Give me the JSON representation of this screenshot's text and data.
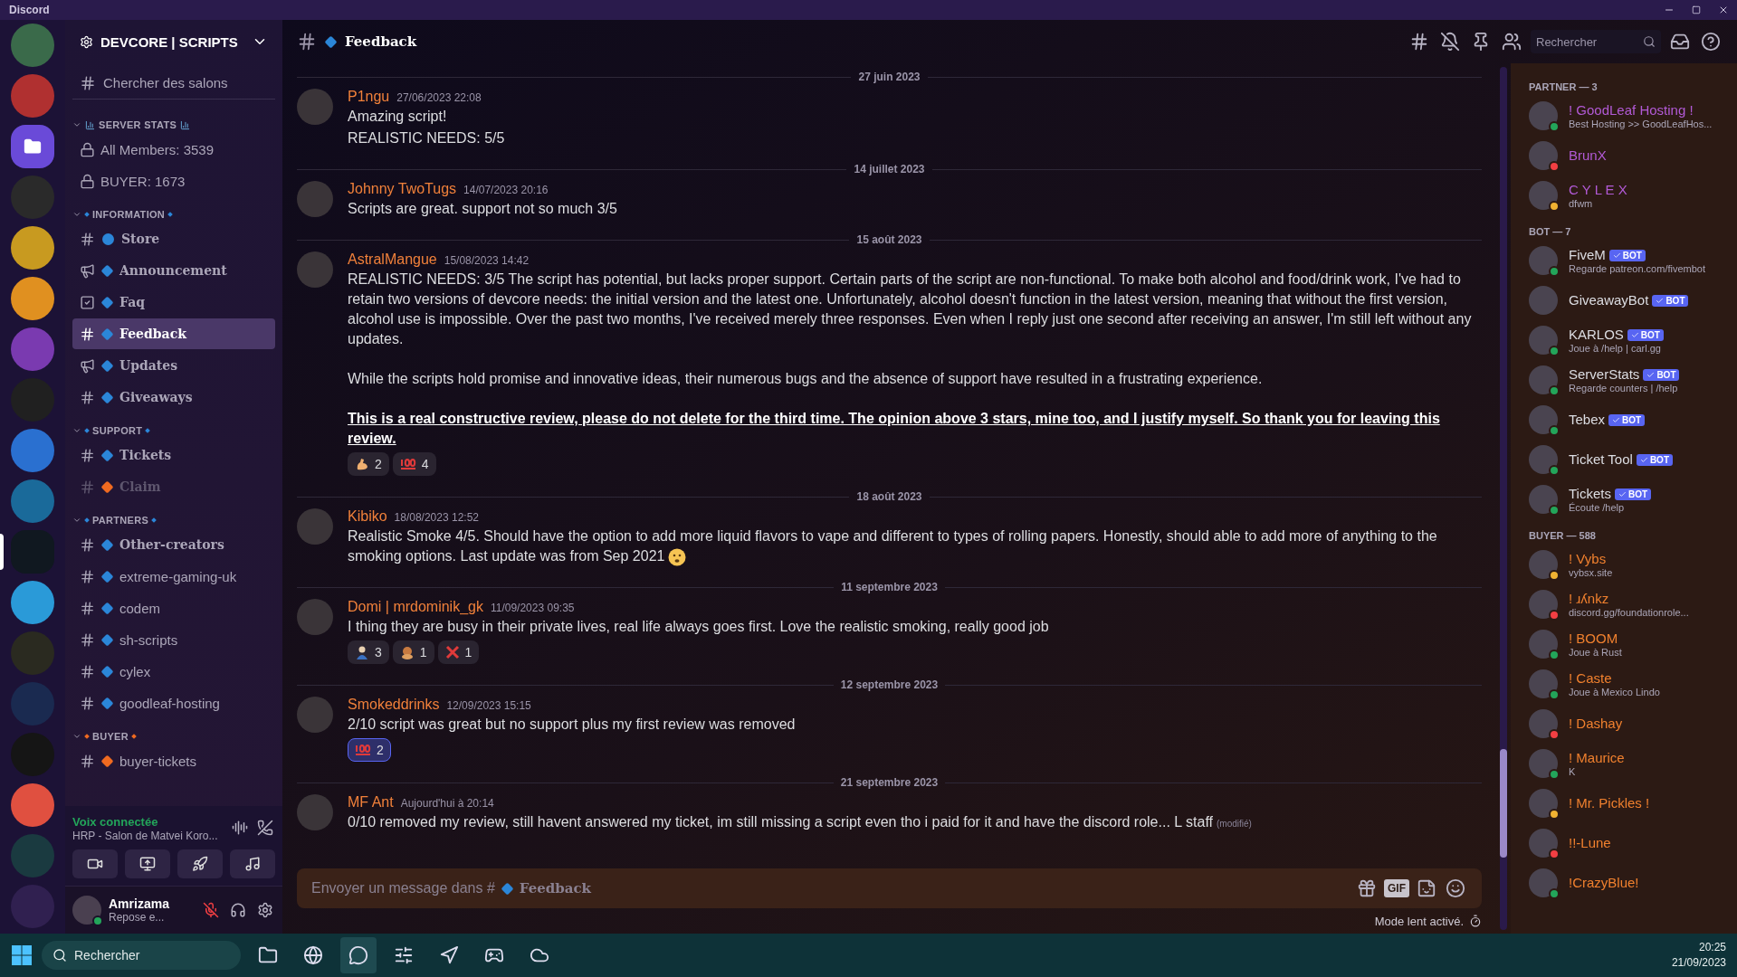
{
  "window": {
    "title": "Discord"
  },
  "servers": [
    {
      "color": "#3a6a4a",
      "selected": false
    },
    {
      "color": "#b03030",
      "selected": false
    },
    {
      "kind": "folder",
      "color": "#6a4ad8",
      "selected": false
    },
    {
      "color": "#2a2a2a",
      "selected": false
    },
    {
      "color": "#c89a20",
      "selected": false
    },
    {
      "color": "#e09020",
      "selected": false
    },
    {
      "color": "#7a3ab0",
      "selected": false
    },
    {
      "color": "#202020",
      "selected": false
    },
    {
      "color": "#2a70d0",
      "selected": false
    },
    {
      "color": "#1a6a9a",
      "selected": false
    },
    {
      "color": "#101820",
      "selected": true
    },
    {
      "color": "#2a9ad8",
      "selected": false
    },
    {
      "color": "#2a2a20",
      "selected": false
    },
    {
      "color": "#1a2a50",
      "selected": false
    },
    {
      "color": "#151515",
      "selected": false
    },
    {
      "color": "#e05040",
      "selected": false
    },
    {
      "color": "#1a3a40",
      "selected": false
    },
    {
      "color": "#302050",
      "selected": false
    }
  ],
  "server": {
    "name": "DEVCORE | SCRIPTS"
  },
  "channel_search": "Chercher des salons",
  "categories": [
    {
      "name": "SERVER STATS",
      "kind": "chart",
      "expanded": true,
      "channels": [
        {
          "name": "All Members: 3539",
          "kind": "locked",
          "serif": false,
          "selected": false,
          "muted": false
        },
        {
          "name": "BUYER: 1673",
          "kind": "locked",
          "serif": false,
          "selected": false,
          "muted": false
        }
      ]
    },
    {
      "name": "INFORMATION",
      "kind": "dots",
      "color": "#2b86d8",
      "expanded": true,
      "channels": [
        {
          "name": "Store",
          "kind": "text",
          "marker": {
            "kind": "circle",
            "color": "#2b86d8"
          },
          "serif": true,
          "selected": false,
          "muted": false
        },
        {
          "name": "Announcement",
          "kind": "announcement",
          "marker": {
            "kind": "diamond",
            "color": "#2b86d8"
          },
          "serif": true,
          "selected": false,
          "muted": false
        },
        {
          "name": "Faq",
          "kind": "checklist",
          "marker": {
            "kind": "diamond",
            "color": "#2b86d8"
          },
          "serif": true,
          "selected": false,
          "muted": false
        },
        {
          "name": "Feedback",
          "kind": "text",
          "marker": {
            "kind": "diamond",
            "color": "#2b86d8"
          },
          "serif": true,
          "selected": true,
          "muted": false
        },
        {
          "name": "Updates",
          "kind": "announcement",
          "marker": {
            "kind": "diamond",
            "color": "#2b86d8"
          },
          "serif": true,
          "selected": false,
          "muted": false
        },
        {
          "name": "Giveaways",
          "kind": "text",
          "marker": {
            "kind": "diamond",
            "color": "#2b86d8"
          },
          "serif": true,
          "selected": false,
          "muted": false
        }
      ]
    },
    {
      "name": "SUPPORT",
      "kind": "dots",
      "color": "#2b86d8",
      "expanded": true,
      "channels": [
        {
          "name": "Tickets",
          "kind": "text",
          "marker": {
            "kind": "diamond",
            "color": "#2b86d8"
          },
          "serif": true,
          "selected": false,
          "muted": false
        },
        {
          "name": "Claim",
          "kind": "text",
          "marker": {
            "kind": "diamond",
            "color": "#f06a20"
          },
          "serif": true,
          "selected": false,
          "muted": true
        }
      ]
    },
    {
      "name": "PARTNERS",
      "kind": "dots",
      "color": "#2b86d8",
      "expanded": true,
      "channels": [
        {
          "name": "Other-creators",
          "kind": "text",
          "marker": {
            "kind": "diamond",
            "color": "#2b86d8"
          },
          "serif": true,
          "selected": false,
          "muted": false
        },
        {
          "name": "extreme-gaming-uk",
          "kind": "text",
          "marker": {
            "kind": "diamond",
            "color": "#2b86d8"
          },
          "serif": false,
          "selected": false,
          "muted": false
        },
        {
          "name": "codem",
          "kind": "text",
          "marker": {
            "kind": "diamond",
            "color": "#2b86d8"
          },
          "serif": false,
          "selected": false,
          "muted": false
        },
        {
          "name": "sh-scripts",
          "kind": "text",
          "marker": {
            "kind": "diamond",
            "color": "#2b86d8"
          },
          "serif": false,
          "selected": false,
          "muted": false
        },
        {
          "name": "cylex",
          "kind": "text",
          "marker": {
            "kind": "diamond",
            "color": "#2b86d8"
          },
          "serif": false,
          "selected": false,
          "muted": false
        },
        {
          "name": "goodleaf-hosting",
          "kind": "text",
          "marker": {
            "kind": "diamond",
            "color": "#2b86d8"
          },
          "serif": false,
          "selected": false,
          "muted": false
        }
      ]
    },
    {
      "name": "BUYER",
      "kind": "dots",
      "color": "#f06a20",
      "expanded": true,
      "channels": [
        {
          "name": "buyer-tickets",
          "kind": "text",
          "marker": {
            "kind": "diamond",
            "color": "#f06a20"
          },
          "serif": false,
          "selected": false,
          "muted": false
        }
      ]
    }
  ],
  "voice": {
    "status": "Voix connectée",
    "channel": "HRP - Salon de Matvei Koro..."
  },
  "user": {
    "name": "Amrizama",
    "status_text": "Repose e...",
    "presence": {
      "kind": "online"
    }
  },
  "header": {
    "channel": "Feedback",
    "search_placeholder": "Rechercher"
  },
  "messages": [
    {
      "date": "27 juin 2023",
      "author": "P1ngu",
      "time": "27/06/2023 22:08",
      "paragraphs": [
        {
          "kind": "line",
          "text": "Amazing script!"
        },
        {
          "kind": "line",
          "text": "REALISTIC NEEDS: 5/5"
        }
      ]
    },
    {
      "date": "14 juillet 2023",
      "author": "Johnny TwoTugs",
      "time": "14/07/2023 20:16",
      "paragraphs": [
        {
          "kind": "line",
          "text": "Scripts are great. support not so much 3/5"
        }
      ]
    },
    {
      "date": "15 août 2023",
      "author": "AstralMangue",
      "time": "15/08/2023 14:42",
      "paragraphs": [
        {
          "kind": "line",
          "text": "REALISTIC NEEDS: 3/5 The script has potential, but lacks proper support. Certain parts of the script are non-functional. To make both alcohol and food/drink work, I've had to retain two versions of devcore needs: the initial version and the latest one. Unfortunately, alcohol doesn't function in the latest version, meaning that without the first version, alcohol use is impossible. Over the past two months, I've received merely three responses. Even when I reply just one second after receiving an answer, I'm still left without any updates."
        },
        {
          "kind": "block",
          "text": "While the scripts hold promise and innovative ideas, their numerous bugs and the absence of support have resulted in a frustrating experience."
        },
        {
          "kind": "strong",
          "text": "This is a real constructive review, please do not delete for the third time. The opinion above 3 stars, mine too, and I justify myself. So thank you for leaving this review."
        }
      ],
      "reactions": [
        {
          "kind": "flexed-arm",
          "count": "2",
          "selected": false
        },
        {
          "kind": "hundred",
          "count": "4",
          "selected": false
        }
      ]
    },
    {
      "date": "18 août 2023",
      "author": "Kibiko",
      "time": "18/08/2023 12:52",
      "paragraphs": [
        {
          "kind": "line",
          "text": "Realistic Smoke 4/5. Should have the option to add more liquid flavors to vape and different to types of rolling papers. Honestly, should able to add more of anything to the smoking options. Last update was from Sep 2021"
        }
      ],
      "emoji": {
        "kind": "sad-face"
      }
    },
    {
      "date": "11 septembre 2023",
      "author": "Domi | mrdominik_gk",
      "time": "11/09/2023 09:35",
      "paragraphs": [
        {
          "kind": "line",
          "text": "I thing they are busy in their private lives, real life always goes first. Love the realistic smoking, really good job"
        }
      ],
      "reactions": [
        {
          "kind": "person",
          "count": "3",
          "selected": false
        },
        {
          "kind": "monkey",
          "count": "1",
          "selected": false
        },
        {
          "kind": "cross",
          "count": "1",
          "selected": false
        }
      ]
    },
    {
      "date": "12 septembre 2023",
      "author": "Smokeddrinks",
      "time": "12/09/2023 15:15",
      "paragraphs": [
        {
          "kind": "line",
          "text": "2/10 script was great but no support plus my first review was removed"
        }
      ],
      "reactions": [
        {
          "kind": "hundred",
          "count": "2",
          "selected": true
        }
      ]
    },
    {
      "date": "21 septembre 2023",
      "author": "MF Ant",
      "time": "Aujourd'hui à 20:14",
      "paragraphs": [
        {
          "kind": "line",
          "text": "0/10 removed my review, still havent answered my ticket, im still missing a script even tho i paid for it and have the discord role... L staff"
        }
      ],
      "edited": "(modifié)"
    }
  ],
  "composer": {
    "prompt": "Envoyer un message dans #",
    "channel": "Feedback",
    "gif_label": "GIF",
    "slowmode": "Mode lent activé."
  },
  "member_groups": [
    {
      "title": "PARTNER — 3",
      "color": "#b25ad6",
      "members": [
        {
          "name": "! GoodLeaf Hosting !",
          "activity": "Best Hosting >> GoodLeafHos...",
          "presence": {
            "kind": "online"
          }
        },
        {
          "name": "BrunX",
          "presence": {
            "kind": "dnd"
          }
        },
        {
          "name": "C Y L E X",
          "activity": "dfwm",
          "presence": {
            "kind": "idle"
          }
        }
      ]
    },
    {
      "title": "BOT — 7",
      "color": "#dcdde2",
      "members": [
        {
          "name": "FiveM",
          "activity": "Regarde patreon.com/fivembot",
          "presence": {
            "kind": "online"
          },
          "tag": "BOT"
        },
        {
          "name": "GiveawayBot",
          "tag": "BOT"
        },
        {
          "name": "KARLOS",
          "activity": "Joue à /help | carl.gg",
          "presence": {
            "kind": "online"
          },
          "tag": "BOT"
        },
        {
          "name": "ServerStats",
          "activity": "Regarde counters | /help",
          "presence": {
            "kind": "online"
          },
          "tag": "BOT"
        },
        {
          "name": "Tebex",
          "presence": {
            "kind": "online"
          },
          "tag": "BOT"
        },
        {
          "name": "Ticket Tool",
          "presence": {
            "kind": "online"
          },
          "tag": "BOT"
        },
        {
          "name": "Tickets",
          "activity": "Écoute /help",
          "presence": {
            "kind": "online"
          },
          "tag": "BOT"
        }
      ]
    },
    {
      "title": "BUYER — 588",
      "color": "#f0802e",
      "members": [
        {
          "name": "! Vybs",
          "activity": "vybsx.site",
          "presence": {
            "kind": "idle"
          }
        },
        {
          "name": "! ɹʎnkz",
          "activity": "discord.gg/foundationrole...",
          "presence": {
            "kind": "dnd"
          }
        },
        {
          "name": "! BOOM",
          "activity": "Joue à Rust",
          "presence": {
            "kind": "online"
          }
        },
        {
          "name": "! Caste",
          "activity": "Joue à Mexico Lindo",
          "presence": {
            "kind": "online"
          }
        },
        {
          "name": "! Dashay",
          "presence": {
            "kind": "dnd"
          }
        },
        {
          "name": "! Maurice",
          "activity": "K",
          "presence": {
            "kind": "online"
          }
        },
        {
          "name": "! Mr. Pickles !",
          "presence": {
            "kind": "idle"
          }
        },
        {
          "name": "!!-Lune",
          "presence": {
            "kind": "dnd"
          }
        },
        {
          "name": "!CrazyBlue!",
          "presence": {
            "kind": "online"
          }
        }
      ]
    }
  ],
  "taskbar": {
    "search_placeholder": "Rechercher",
    "apps": [
      {
        "kind": "folder",
        "selected": false
      },
      {
        "kind": "browser",
        "selected": false
      },
      {
        "kind": "chat",
        "selected": true
      },
      {
        "kind": "mixer",
        "selected": false
      },
      {
        "kind": "nav",
        "selected": false
      },
      {
        "kind": "games",
        "selected": false
      },
      {
        "kind": "cloud",
        "selected": false
      }
    ],
    "time": "20:25",
    "date": "21/09/2023"
  }
}
